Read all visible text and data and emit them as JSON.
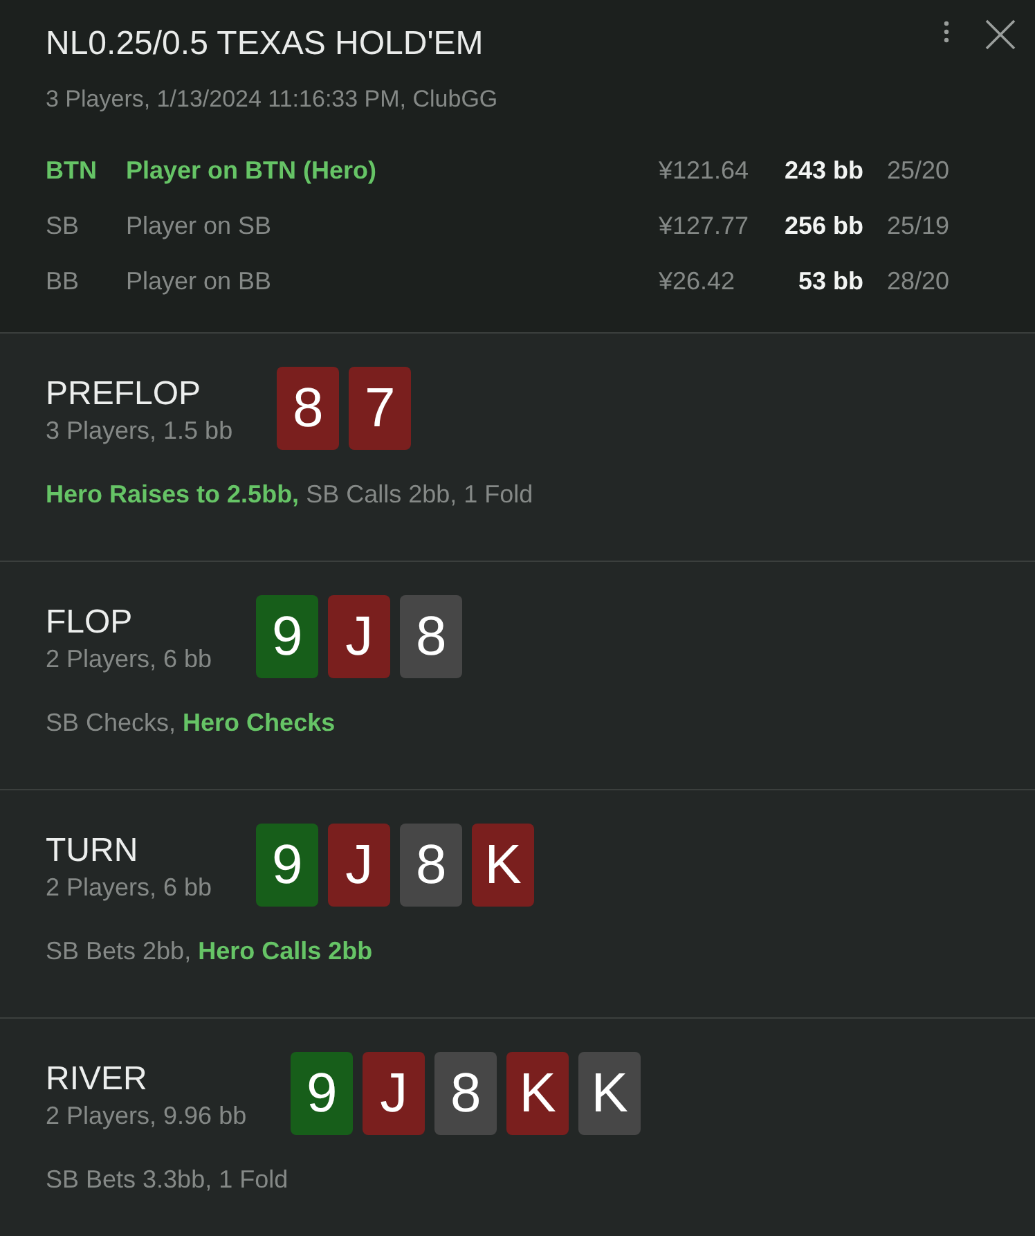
{
  "panel": {
    "title": "NL0.25/0.5 TEXAS HOLD'EM",
    "subtitle": "3 Players, 1/13/2024 11:16:33 PM, ClubGG"
  },
  "players": [
    {
      "position": "BTN",
      "name": "Player on BTN (Hero)",
      "stack": "¥121.64",
      "stack_bb": "243 bb",
      "ratio": "25/20",
      "hero": true
    },
    {
      "position": "SB",
      "name": "Player on SB",
      "stack": "¥127.77",
      "stack_bb": "256 bb",
      "ratio": "25/19",
      "hero": false
    },
    {
      "position": "BB",
      "name": "Player on BB",
      "stack": "¥26.42",
      "stack_bb": "53 bb",
      "ratio": "28/20",
      "hero": false
    }
  ],
  "streets": [
    {
      "name": "PREFLOP",
      "summary": "3 Players, 1.5 bb",
      "cards": [
        {
          "rank": "8",
          "color": "#7a1f1e"
        },
        {
          "rank": "7",
          "color": "#7a1f1e"
        }
      ],
      "actions": "**Hero Raises to 2.5bb,** SB Calls 2bb, 1 Fold"
    },
    {
      "name": "FLOP",
      "summary": "2 Players, 6 bb",
      "cards": [
        {
          "rank": "9",
          "color": "#175e1a"
        },
        {
          "rank": "J",
          "color": "#7a1f1e"
        },
        {
          "rank": "8",
          "color": "#474747"
        }
      ],
      "actions": "SB Checks, **Hero Checks**"
    },
    {
      "name": "TURN",
      "summary": "2 Players, 6 bb",
      "cards": [
        {
          "rank": "9",
          "color": "#175e1a"
        },
        {
          "rank": "J",
          "color": "#7a1f1e"
        },
        {
          "rank": "8",
          "color": "#474747"
        },
        {
          "rank": "K",
          "color": "#7a1f1e"
        }
      ],
      "actions": "SB Bets 2bb, **Hero Calls 2bb**"
    },
    {
      "name": "RIVER",
      "summary": "2 Players, 9.96 bb",
      "cards": [
        {
          "rank": "9",
          "color": "#175e1a"
        },
        {
          "rank": "J",
          "color": "#7a1f1e"
        },
        {
          "rank": "8",
          "color": "#474747"
        },
        {
          "rank": "K",
          "color": "#7a1f1e"
        },
        {
          "rank": "K",
          "color": "#474747"
        }
      ],
      "actions": "SB Bets 3.3bb, 1 Fold"
    }
  ]
}
